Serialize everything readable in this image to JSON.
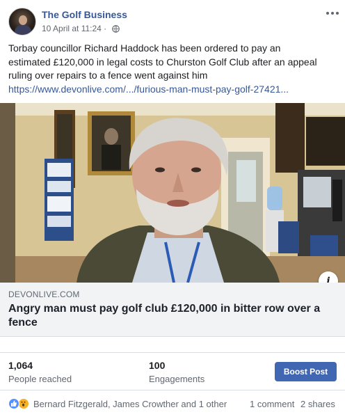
{
  "post": {
    "page_name": "The Golf Business",
    "timestamp": "10 April at 11:24 ·",
    "privacy_icon": "globe-icon",
    "more_icon": "more-options-icon",
    "message_lines": [
      "Torbay councillor Richard Haddock has been ordered to pay an",
      "estimated £120,000 in legal costs to Churston Golf Club after an appeal",
      "ruling over repairs to a fence went against him"
    ],
    "link_url": "https://www.devonlive.com/.../furious-man-must-pay-golf-27421..."
  },
  "link_preview": {
    "domain": "DEVONLIVE.COM",
    "headline": "Angry man must pay golf club £120,000 in bitter row over a fence",
    "info_label": "i"
  },
  "stats": {
    "reached_count": "1,064",
    "reached_label": "People reached",
    "engagements_count": "100",
    "engagements_label": "Engagements",
    "boost_label": "Boost Post"
  },
  "reactions": {
    "names": "Bernard Fitzgerald, James Crowther and 1 other",
    "comments": "1 comment",
    "shares": "2 shares",
    "icons": [
      "like-icon",
      "wow-icon"
    ]
  },
  "colors": {
    "link": "#365899",
    "boost": "#4267b2",
    "like": "#5890ff",
    "wow": "#f7b125"
  }
}
